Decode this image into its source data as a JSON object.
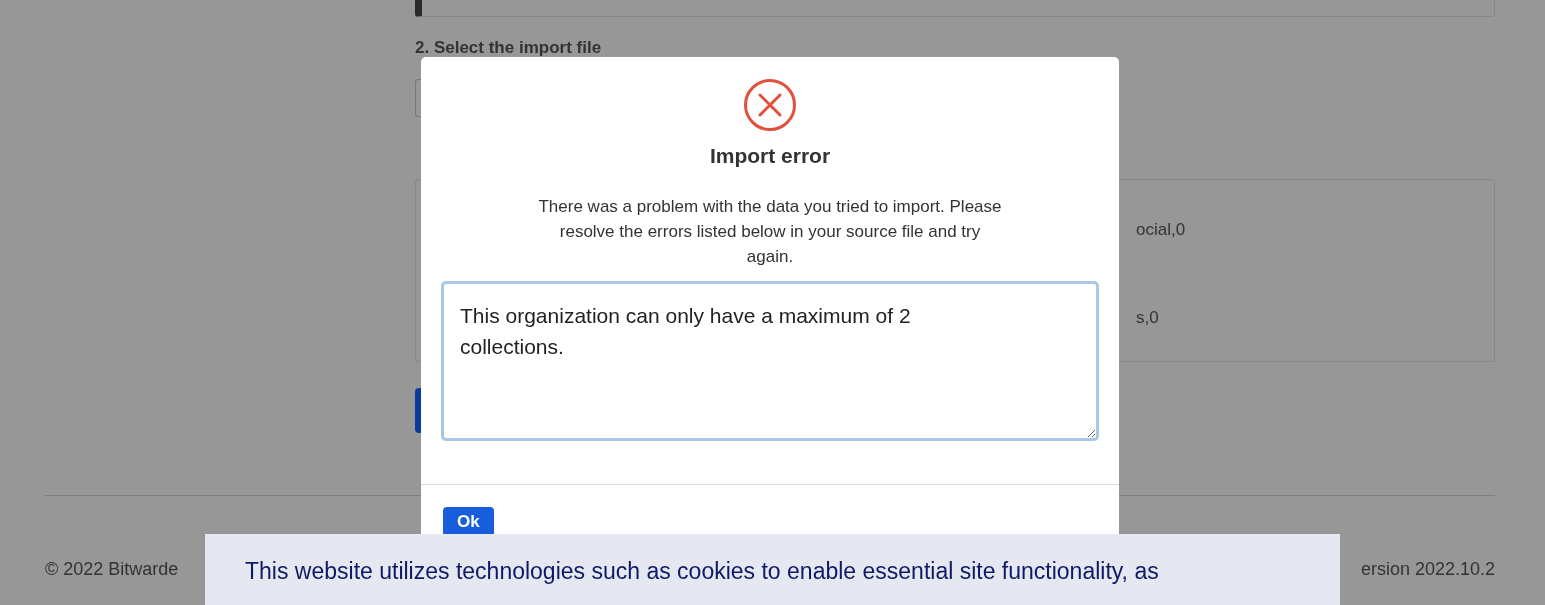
{
  "background_form": {
    "file_label": "2. Select the import file",
    "contents_lines": [
      "ocial,0",
      "s,0"
    ]
  },
  "footer": {
    "copyright": "© 2022 Bitwarde",
    "version": "ersion 2022.10.2"
  },
  "dialog": {
    "title": "Import error",
    "message": "There was a problem with the data you tried to import. Please resolve the errors listed below in your source file and try again.",
    "errors": "This organization can only have a maximum of 2 collections.",
    "buttons": [
      "Ok"
    ]
  },
  "cookie_banner": {
    "text": "This website utilizes technologies such as cookies to enable essential site functionality, as"
  }
}
